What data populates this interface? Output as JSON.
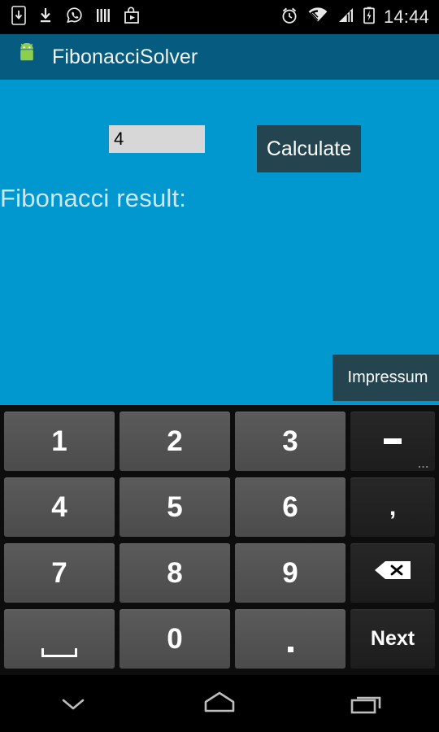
{
  "status_bar": {
    "time": "14:44",
    "left_icons": [
      {
        "name": "phone-download-icon",
        "label": "download-to-phone"
      },
      {
        "name": "download-icon",
        "label": "download"
      },
      {
        "name": "whatsapp-icon",
        "label": "whatsapp"
      },
      {
        "name": "barcode-icon",
        "label": "barcode"
      },
      {
        "name": "play-store-bag-icon",
        "label": "play-store"
      }
    ],
    "right_icons": [
      {
        "name": "alarm-clock-icon",
        "label": "alarm"
      },
      {
        "name": "wifi-icon",
        "label": "wifi"
      },
      {
        "name": "cellular-signal-icon",
        "label": "signal"
      },
      {
        "name": "battery-charging-icon",
        "label": "battery-charging"
      }
    ]
  },
  "action_bar": {
    "title": "FibonacciSolver",
    "icon": "android-robot-icon",
    "background_color": "#065c80"
  },
  "app": {
    "background_color": "#0098ce",
    "input": {
      "value": "4",
      "placeholder": ""
    },
    "calculate_button": {
      "label": "Calculate",
      "color": "#24454f"
    },
    "result_label": "Fibonacci result:",
    "result_value": "",
    "impressum_button": {
      "label": "Impressum",
      "color": "#24454f"
    }
  },
  "keyboard": {
    "type": "numeric",
    "rows": [
      [
        {
          "label": "1",
          "kind": "num",
          "name": "key-1"
        },
        {
          "label": "2",
          "kind": "num",
          "name": "key-2"
        },
        {
          "label": "3",
          "kind": "num",
          "name": "key-3"
        },
        {
          "label": "-",
          "kind": "fn",
          "name": "key-minus",
          "glyph": "dash",
          "corner": "..."
        }
      ],
      [
        {
          "label": "4",
          "kind": "num",
          "name": "key-4"
        },
        {
          "label": "5",
          "kind": "num",
          "name": "key-5"
        },
        {
          "label": "6",
          "kind": "num",
          "name": "key-6"
        },
        {
          "label": ",",
          "kind": "fn",
          "name": "key-comma"
        }
      ],
      [
        {
          "label": "7",
          "kind": "num",
          "name": "key-7"
        },
        {
          "label": "8",
          "kind": "num",
          "name": "key-8"
        },
        {
          "label": "9",
          "kind": "num",
          "name": "key-9"
        },
        {
          "label": "",
          "kind": "fn",
          "name": "key-backspace",
          "glyph": "backspace"
        }
      ],
      [
        {
          "label": "",
          "kind": "num",
          "name": "key-space",
          "glyph": "space"
        },
        {
          "label": "0",
          "kind": "num",
          "name": "key-0"
        },
        {
          "label": "",
          "kind": "num",
          "name": "key-period",
          "glyph": "dot"
        },
        {
          "label": "Next",
          "kind": "fn",
          "name": "key-next"
        }
      ]
    ]
  },
  "nav_bar": {
    "buttons": [
      {
        "name": "hide-keyboard-icon",
        "label": "back"
      },
      {
        "name": "home-icon",
        "label": "home"
      },
      {
        "name": "recents-icon",
        "label": "recents"
      }
    ]
  }
}
